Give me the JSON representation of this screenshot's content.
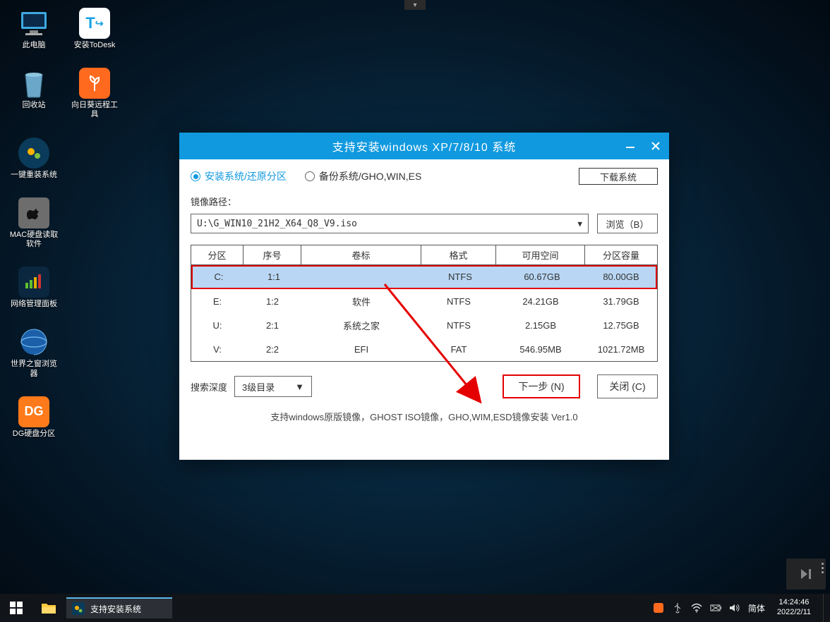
{
  "desktop_icons": [
    [
      {
        "name": "此电脑"
      },
      {
        "name": "安装ToDesk"
      }
    ],
    [
      {
        "name": "回收站"
      },
      {
        "name": "向日葵远程工具"
      }
    ],
    [
      {
        "name": "一键重装系统"
      }
    ],
    [
      {
        "name": "MAC硬盘读取软件"
      }
    ],
    [
      {
        "name": "网络管理面板"
      }
    ],
    [
      {
        "name": "世界之窗浏览器"
      }
    ],
    [
      {
        "name": "DG硬盘分区"
      }
    ]
  ],
  "dialog": {
    "title": "支持安装windows XP/7/8/10 系统",
    "radios": {
      "install": "安装系统/还原分区",
      "backup": "备份系统/GHO,WIN,ES"
    },
    "download_system": "下载系统",
    "path_label": "镜像路径：",
    "path_value": "U:\\G_WIN10_21H2_X64_Q8_V9.iso",
    "browse": "浏览（B）",
    "columns": {
      "partition": "分区",
      "index": "序号",
      "label": "卷标",
      "format": "格式",
      "free": "可用空间",
      "size": "分区容量"
    },
    "rows": [
      {
        "partition": "C:",
        "index": "1:1",
        "label": "",
        "format": "NTFS",
        "free": "60.67GB",
        "size": "80.00GB",
        "selected": true
      },
      {
        "partition": "E:",
        "index": "1:2",
        "label": "软件",
        "format": "NTFS",
        "free": "24.21GB",
        "size": "31.79GB"
      },
      {
        "partition": "U:",
        "index": "2:1",
        "label": "系统之家",
        "format": "NTFS",
        "free": "2.15GB",
        "size": "12.75GB"
      },
      {
        "partition": "V:",
        "index": "2:2",
        "label": "EFI",
        "format": "FAT",
        "free": "546.95MB",
        "size": "1021.72MB"
      }
    ],
    "depth_label": "搜索深度",
    "depth_value": "3级目录",
    "next": "下一步 (N)",
    "close": "关闭 (C)",
    "footer": "支持windows原版镜像，GHOST ISO镜像，GHO,WIM,ESD镜像安装 Ver1.0"
  },
  "taskbar": {
    "app_title": "支持安装系统",
    "ime": "简体",
    "time": "14:24:46",
    "date": "2022/2/11"
  }
}
